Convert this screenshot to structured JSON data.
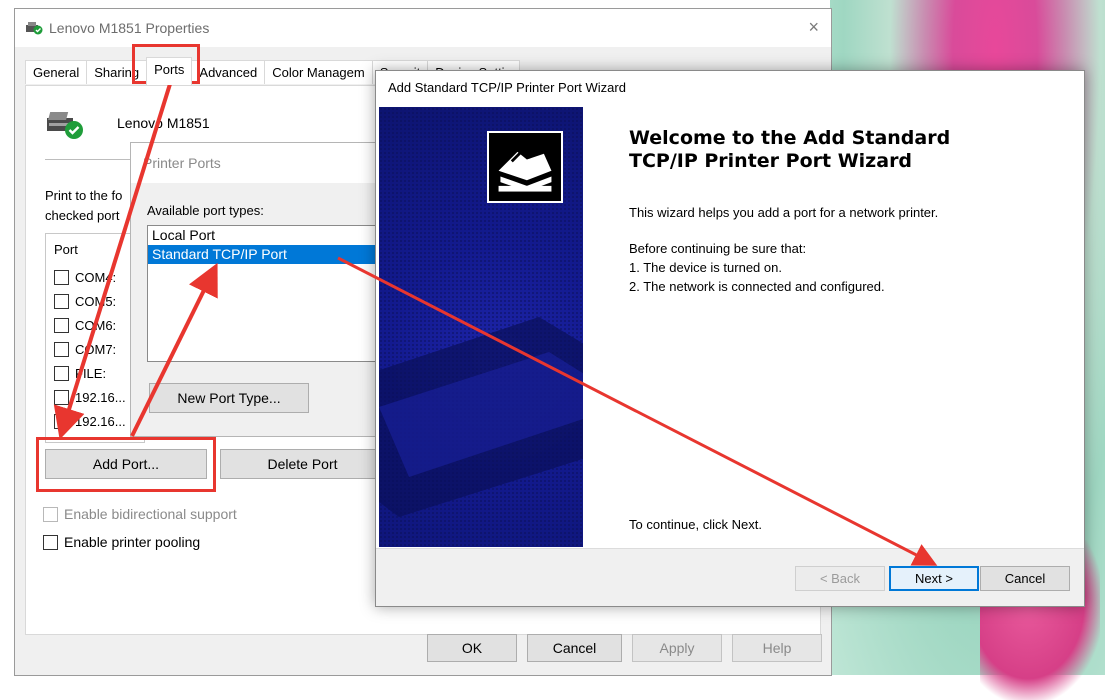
{
  "properties_window": {
    "title": "Lenovo M1851 Properties",
    "close_glyph": "×",
    "tabs": [
      {
        "label": "General"
      },
      {
        "label": "Sharing"
      },
      {
        "label": "Ports"
      },
      {
        "label": "Advanced"
      },
      {
        "label": "Color Managem"
      },
      {
        "label": "Securit"
      },
      {
        "label": "Device Settin"
      }
    ],
    "active_tab": "Ports",
    "printer_name": "Lenovo M1851",
    "description_line1": "Print to the fo",
    "description_line2": "checked port",
    "port_list": {
      "header": "Port",
      "items": [
        {
          "label": "COM4:",
          "checked": false
        },
        {
          "label": "COM5:",
          "checked": false
        },
        {
          "label": "COM6:",
          "checked": false
        },
        {
          "label": "COM7:",
          "checked": false
        },
        {
          "label": "FILE:",
          "checked": false
        },
        {
          "label": "192.16...",
          "checked": false
        },
        {
          "label": "192.16...",
          "checked": true
        }
      ]
    },
    "add_port_label": "Add Port...",
    "delete_port_label": "Delete Port",
    "bidirectional_label": "Enable bidirectional support",
    "pooling_label": "Enable printer pooling",
    "ok_label": "OK",
    "cancel_label": "Cancel",
    "apply_label": "Apply",
    "help_label": "Help"
  },
  "printer_ports_dialog": {
    "title": "Printer Ports",
    "available_label": "Available port types:",
    "port_types": [
      "Local Port",
      "Standard TCP/IP Port"
    ],
    "selected": "Standard TCP/IP Port",
    "new_port_type_label": "New Port Type..."
  },
  "wizard": {
    "title": "Add Standard TCP/IP Printer Port Wizard",
    "heading_line1": "Welcome to the Add Standard",
    "heading_line2": "TCP/IP Printer Port Wizard",
    "intro": "This wizard helps you add a port for a network printer.",
    "before_label": "Before continuing be sure that:",
    "step1": "1.  The device is turned on.",
    "step2": "2.  The network is connected and configured.",
    "continue_text": "To continue, click Next.",
    "back_label": "< Back",
    "next_label": "Next >",
    "cancel_label": "Cancel"
  },
  "colors": {
    "annotation_red": "#e8362f",
    "selection_blue": "#0078d7",
    "wizard_banner_blue": "#131a8f"
  },
  "icons": [
    "printer-check-icon",
    "wizard-printer-logo-icon",
    "close-icon"
  ]
}
